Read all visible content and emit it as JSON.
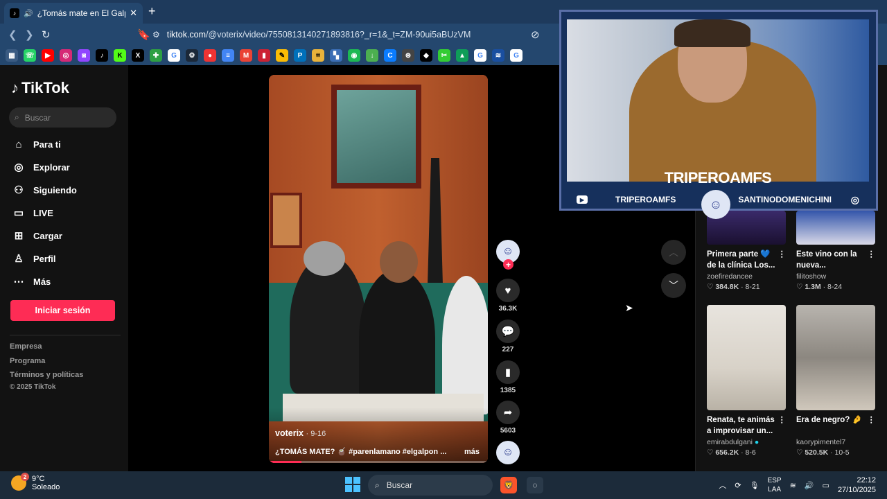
{
  "browser": {
    "tab_title": "¿Tomás mate en El Galpón? |",
    "url_host": "tiktok.com",
    "url_path": "/@voterix/video/7550813140271893816?_r=1&_t=ZM-90ui5aBUzVM"
  },
  "sidebar": {
    "logo": "TikTok",
    "search_placeholder": "Buscar",
    "items": [
      {
        "label": "Para ti",
        "icon": "home-icon"
      },
      {
        "label": "Explorar",
        "icon": "compass-icon"
      },
      {
        "label": "Siguiendo",
        "icon": "user-icon"
      },
      {
        "label": "LIVE",
        "icon": "live-icon"
      },
      {
        "label": "Cargar",
        "icon": "upload-icon"
      },
      {
        "label": "Perfil",
        "icon": "profile-icon"
      },
      {
        "label": "Más",
        "icon": "more-icon"
      }
    ],
    "login_label": "Iniciar sesión",
    "footer": [
      "Empresa",
      "Programa",
      "Términos y políticas",
      "© 2025 TikTok"
    ]
  },
  "video": {
    "author": "voterix",
    "date": "· 9-16",
    "caption": "¿TOMÁS MATE? 🧉 #parenlamano #elgalpon ...",
    "more_label": "más",
    "progress": 0.15,
    "likes": "36.3K",
    "comments": "227",
    "saves": "1385",
    "shares": "5603"
  },
  "stream_overlay": {
    "streamer_name": "TRIPEROAMFS",
    "youtube_handle": "TRIPEROAMFS",
    "instagram_handle": "SANTINODOMENICHINI"
  },
  "recommended": [
    {
      "title": "Primera parte 💙 de la clínica Los...",
      "author": "zoefiredancee",
      "likes": "384.8K",
      "date": "8-21"
    },
    {
      "title": "Este vino con la nueva...",
      "author": "filitoshow",
      "likes": "1.3M",
      "date": "8-24"
    },
    {
      "title": "Renata, te animás a improvisar un...",
      "author": "emirabdulgani",
      "likes": "656.2K",
      "date": "8-6"
    },
    {
      "title": "Era de negro? 🤌",
      "author": "kaorypimentel7",
      "likes": "520.5K",
      "date": "10-5"
    }
  ],
  "taskbar": {
    "temperature": "9°C",
    "weather": "Soleado",
    "search_label": "Buscar",
    "lang_top": "ESP",
    "lang_bottom": "LAA",
    "time": "22:12",
    "date": "27/10/2025"
  },
  "colors": {
    "accent": "#fe2c55",
    "chrome": "#24476e",
    "overlay": "#16305c"
  }
}
